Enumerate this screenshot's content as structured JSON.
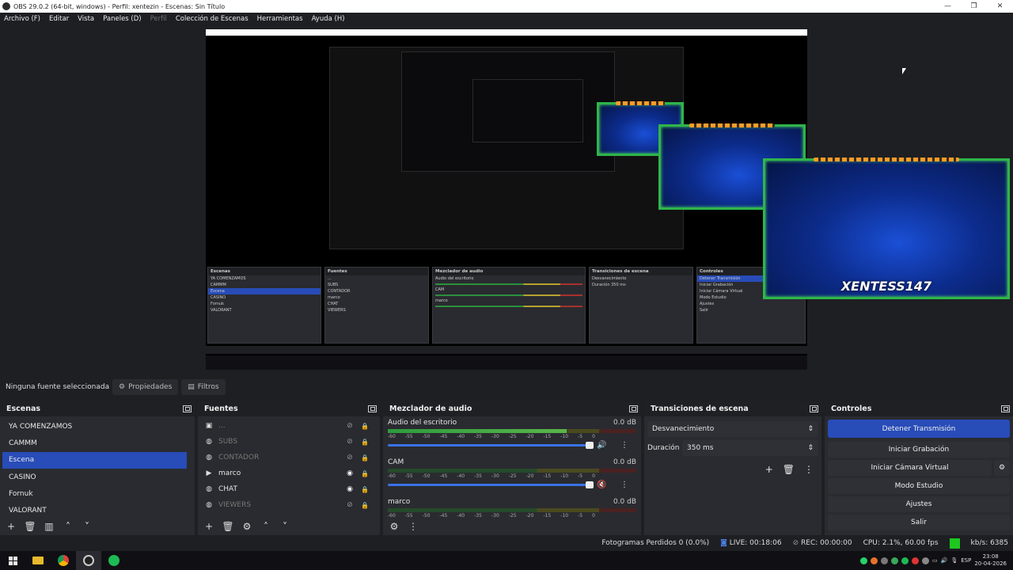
{
  "window": {
    "title": "OBS 29.0.2 (64-bit, windows) - Perfil: xentezin - Escenas: Sin Título"
  },
  "menu": {
    "items": [
      "Archivo (F)",
      "Editar",
      "Vista",
      "Paneles (D)",
      "Perfil",
      "Colección de Escenas",
      "Herramientas",
      "Ayuda (H)"
    ]
  },
  "preview": {
    "cam_logo": "XENTESS147"
  },
  "props_bar": {
    "no_source": "Ninguna fuente seleccionada",
    "properties": "Propiedades",
    "filters": "Filtros"
  },
  "scenes": {
    "title": "Escenas",
    "items": [
      "YA COMENZAMOS",
      "CAMMM",
      "Escena",
      "CASINO",
      "Fornuk",
      "VALORANT"
    ],
    "selected_index": 2
  },
  "sources": {
    "title": "Fuentes",
    "items": [
      {
        "name": "...",
        "icon": "image-icon",
        "visible": false
      },
      {
        "name": "SUBS",
        "icon": "browser-icon",
        "visible": false
      },
      {
        "name": "CONTADOR",
        "icon": "browser-icon",
        "visible": false
      },
      {
        "name": "marco",
        "icon": "play-icon",
        "visible": true
      },
      {
        "name": "CHAT",
        "icon": "browser-icon",
        "visible": true
      },
      {
        "name": "VIEWERS",
        "icon": "browser-icon",
        "visible": false
      }
    ]
  },
  "mixer": {
    "title": "Mezclador de audio",
    "scale": [
      "-60",
      "-55",
      "-50",
      "-45",
      "-40",
      "-35",
      "-30",
      "-25",
      "-20",
      "-15",
      "-10",
      "-5",
      "0"
    ],
    "channels": [
      {
        "name": "Audio del escritorio",
        "db": "0.0 dB",
        "level": 0.72,
        "muted": false
      },
      {
        "name": "CAM",
        "db": "0.0 dB",
        "level": 0.0,
        "muted": true
      },
      {
        "name": "marco",
        "db": "0.0 dB",
        "level": 0.0,
        "muted": false
      }
    ]
  },
  "transitions": {
    "title": "Transiciones de escena",
    "selected": "Desvanecimiento",
    "duration_label": "Duración",
    "duration_value": "350 ms"
  },
  "controls": {
    "title": "Controles",
    "stop_stream": "Detener Transmisión",
    "start_recording": "Iniciar Grabación",
    "start_virtual_cam": "Iniciar Cámara Virtual",
    "studio_mode": "Modo Estudio",
    "settings": "Ajustes",
    "exit": "Salir"
  },
  "status": {
    "dropped": "Fotogramas Perdidos 0 (0.0%)",
    "live": "LIVE: 00:18:06",
    "rec": "REC: 00:00:00",
    "cpu": "CPU: 2.1%, 60.00 fps",
    "kbps": "kb/s: 6385"
  },
  "taskbar": {
    "lang": "ESP",
    "time": "23:08",
    "date": "20-04-2026"
  },
  "colors": {
    "accent": "#284cb8",
    "live_green": "#1ec71e",
    "cam_border": "#2fb54a"
  }
}
